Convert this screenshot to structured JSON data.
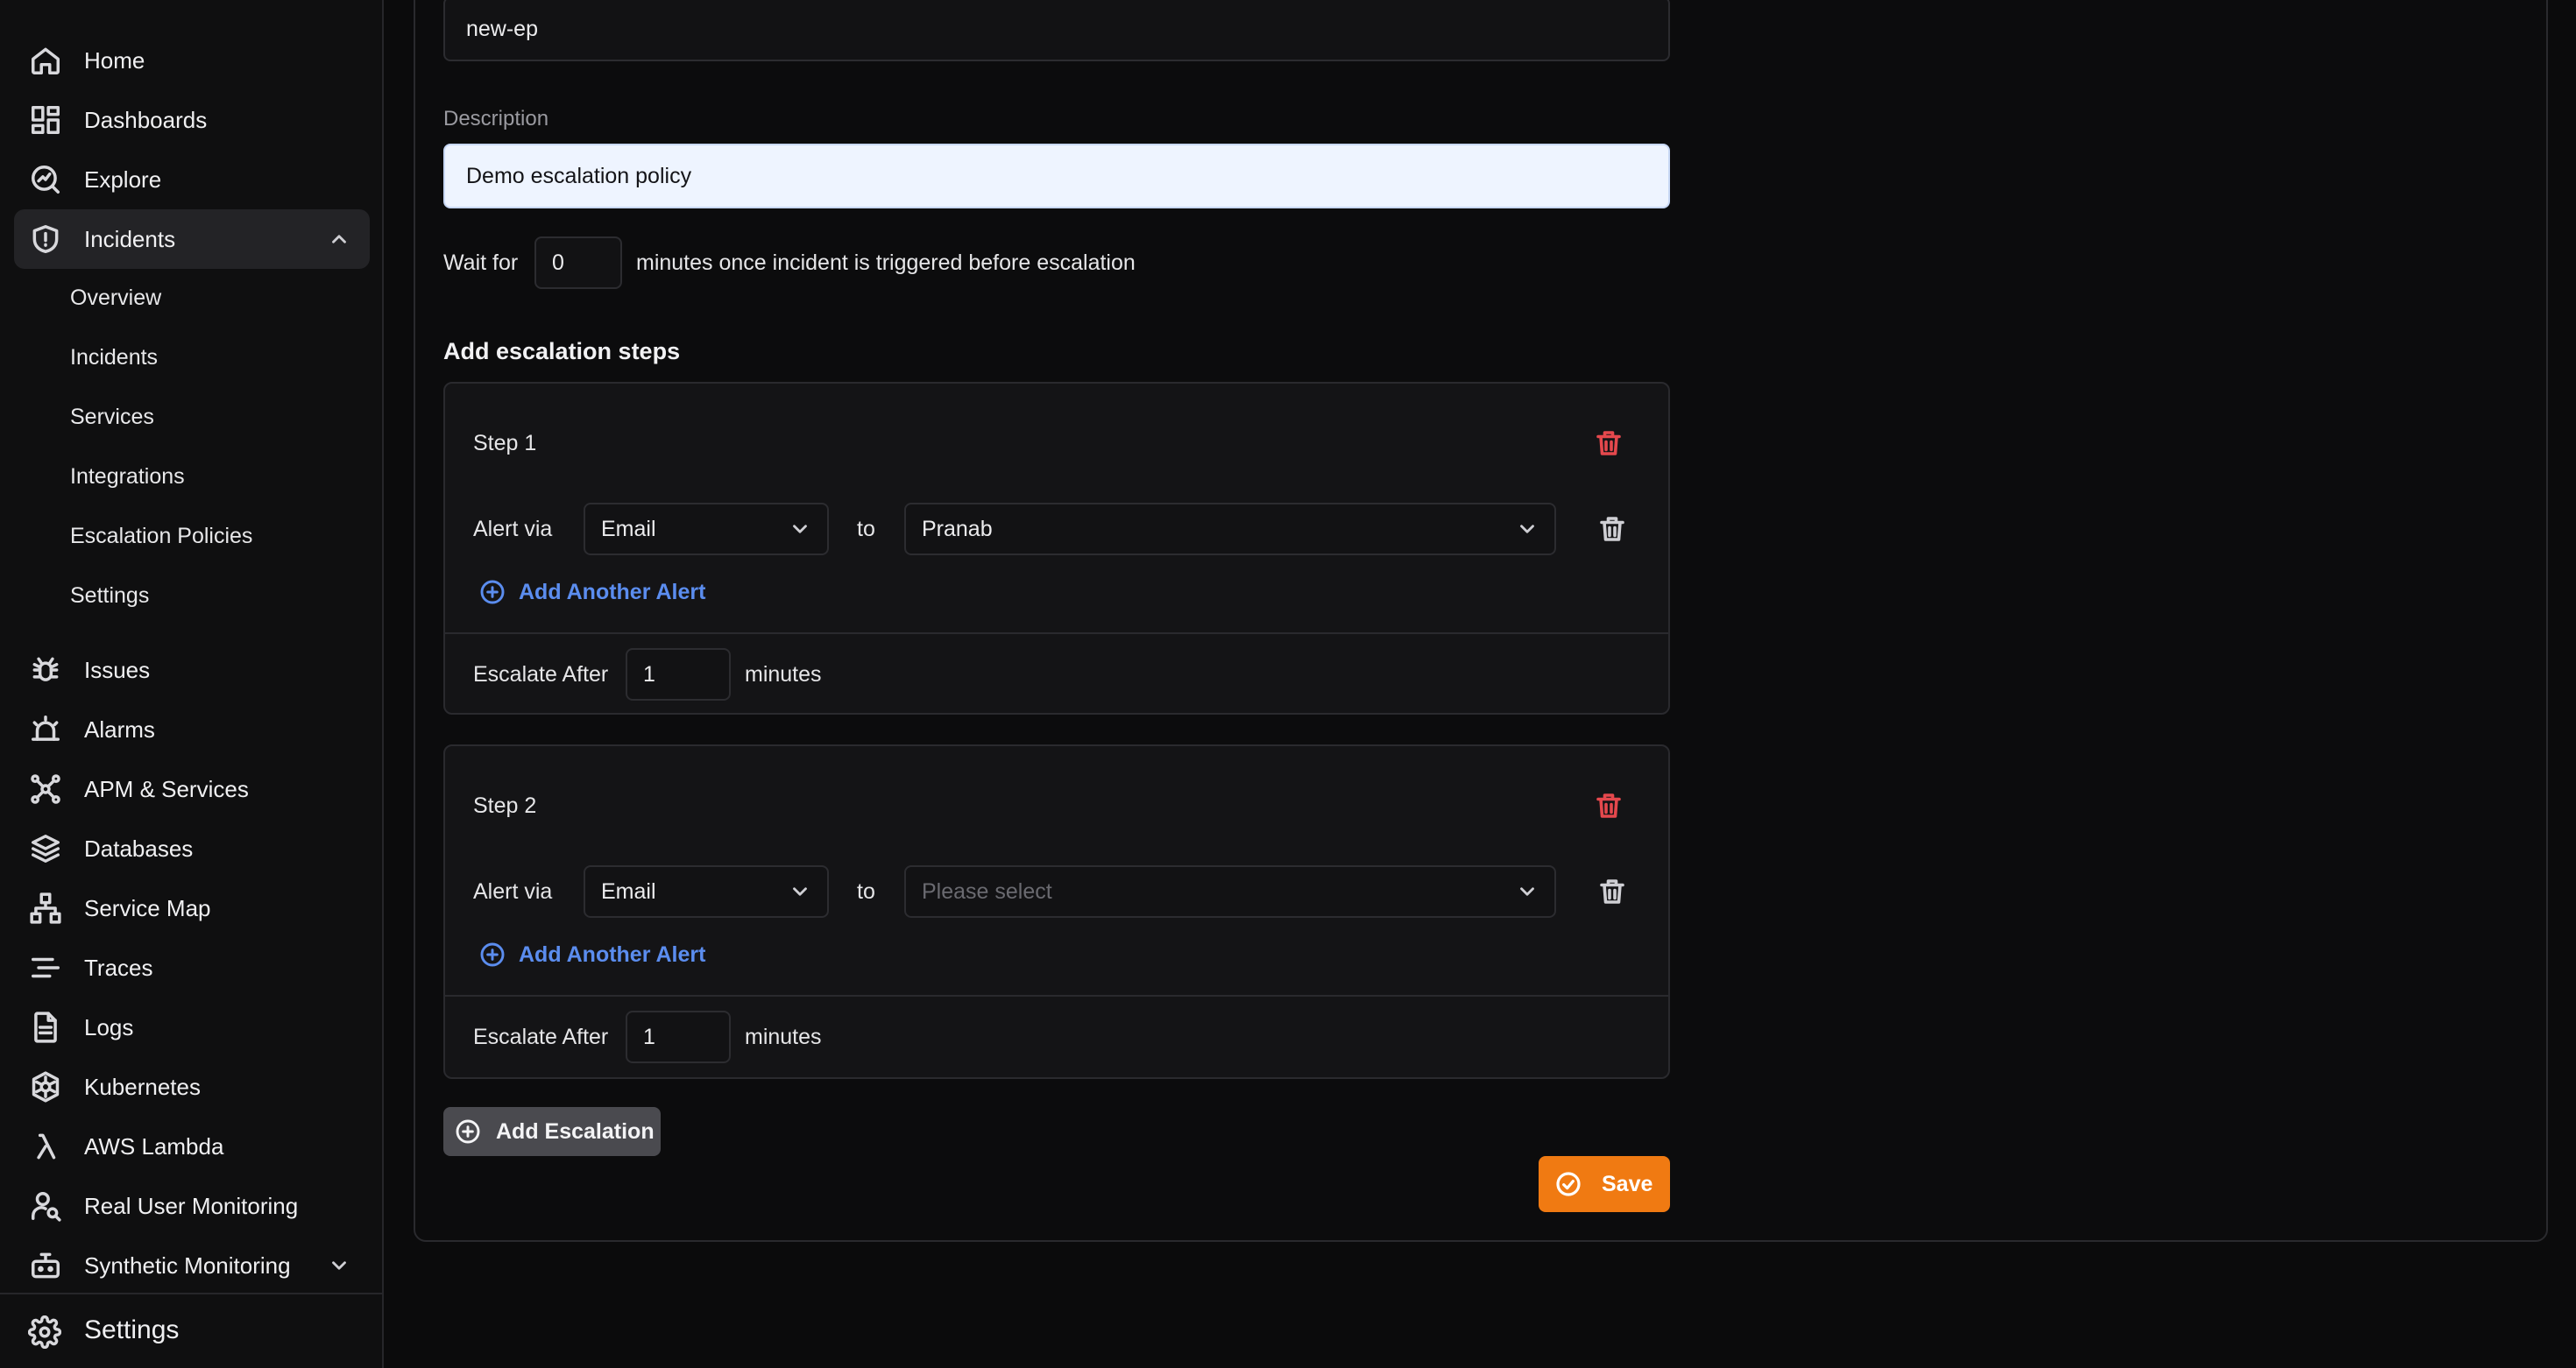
{
  "sidebar": {
    "items": [
      {
        "label": "Home",
        "icon": "home-icon"
      },
      {
        "label": "Dashboards",
        "icon": "dashboards-icon"
      },
      {
        "label": "Explore",
        "icon": "explore-icon"
      },
      {
        "label": "Incidents",
        "icon": "shield-icon",
        "expanded": true
      },
      {
        "label": "Issues",
        "icon": "bug-icon"
      },
      {
        "label": "Alarms",
        "icon": "alarm-icon"
      },
      {
        "label": "APM & Services",
        "icon": "apm-icon"
      },
      {
        "label": "Databases",
        "icon": "database-icon"
      },
      {
        "label": "Service Map",
        "icon": "service-map-icon"
      },
      {
        "label": "Traces",
        "icon": "traces-icon"
      },
      {
        "label": "Logs",
        "icon": "logs-icon"
      },
      {
        "label": "Kubernetes",
        "icon": "kubernetes-icon"
      },
      {
        "label": "AWS Lambda",
        "icon": "lambda-icon"
      },
      {
        "label": "Real User Monitoring",
        "icon": "user-monitoring-icon"
      },
      {
        "label": "Synthetic Monitoring",
        "icon": "robot-icon"
      }
    ],
    "incidents_sub": [
      "Overview",
      "Incidents",
      "Services",
      "Integrations",
      "Escalation Policies",
      "Settings"
    ],
    "bottom": {
      "label": "Settings",
      "icon": "gear-icon"
    }
  },
  "form": {
    "name_value": "new-ep",
    "description_label": "Description",
    "description_value": "Demo escalation policy",
    "wait_prefix": "Wait for",
    "wait_value": "0",
    "wait_suffix": "minutes once incident is triggered before escalation",
    "steps_heading": "Add escalation steps",
    "steps": [
      {
        "title": "Step 1",
        "alert_via_label": "Alert via",
        "channel": "Email",
        "to_label": "to",
        "recipient": "Pranab",
        "recipient_placeholder": "",
        "add_alert_label": "Add Another Alert",
        "escalate_label": "Escalate After",
        "escalate_value": "1",
        "minutes_label": "minutes"
      },
      {
        "title": "Step 2",
        "alert_via_label": "Alert via",
        "channel": "Email",
        "to_label": "to",
        "recipient": "",
        "recipient_placeholder": "Please select",
        "add_alert_label": "Add Another Alert",
        "escalate_label": "Escalate After",
        "escalate_value": "1",
        "minutes_label": "minutes"
      }
    ],
    "add_escalation_label": "Add Escalation",
    "save_label": "Save"
  },
  "colors": {
    "accent": "#f07a12",
    "link": "#5b8def",
    "danger": "#e5484d",
    "description_field_bg": "#eef4ff"
  }
}
